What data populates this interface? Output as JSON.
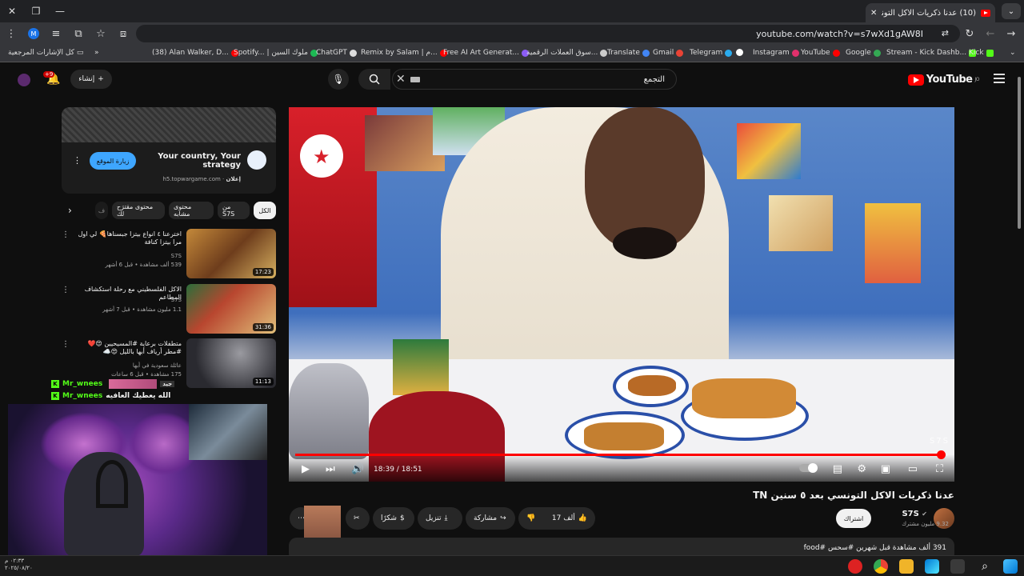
{
  "browser": {
    "tab_title": "(10) عدنا ذكريات الاكل التونسي بـ",
    "url": "youtube.com/watch?v=s7wXd1gAW8I",
    "bookmarks": [
      {
        "label": "كل الإشارات المرجعية"
      },
      {
        "label": "(38) Alan Walker, D..."
      },
      {
        "label": "Spotify... | ملوك السين"
      },
      {
        "label": "ChatGPT"
      },
      {
        "label": "Remix by Salam | م..."
      },
      {
        "label": "Free AI Art Generat..."
      },
      {
        "label": "سوق العملات الرقمية..."
      },
      {
        "label": "Translate"
      },
      {
        "label": "Gmail"
      },
      {
        "label": "Telegram"
      },
      {
        "label": "Instagram"
      },
      {
        "label": "YouTube"
      },
      {
        "label": "Google"
      },
      {
        "label": "Stream - Kick Dashb..."
      },
      {
        "label": "Kick"
      }
    ]
  },
  "header": {
    "logo_text": "YouTube",
    "logo_sup": "JO",
    "search_value": "التجمع",
    "create_label": "إنشاء",
    "notif_count": "+9"
  },
  "ad": {
    "title": "Your country, Your strategy",
    "sponsor": "إعلان",
    "domain": "h5.topwargame.com",
    "cta": "زيارة الموقع"
  },
  "chips": [
    "الكل",
    "من S7S",
    "محتوى مشابه",
    "محتوى مقترَح لك",
    "ف"
  ],
  "recommendations": [
    {
      "title": "اخترعنا ٤ انواع بيتزا جبسناها🍕 لي اول مرا بيتزا كنافة",
      "channel": "S7S",
      "views": "539 ألف مشاهدة • قبل 6 أشهر",
      "duration": "17:23"
    },
    {
      "title": "الاكل الفلسطيني مع رحلة استكشاف المطاعم",
      "channel": "S7S",
      "views": "1.1 مليون مشاهدة • قبل 7 أشهر",
      "duration": "31:36"
    },
    {
      "title": "متطفلات برعاية #المسيحيين 😍❤️ #مطر أرياف أبها بالليل 😍☁️",
      "channel": "عائلة سعودية في أبها",
      "views": "175 مشاهدة • قبل 6 ساعات",
      "duration": "11:13"
    }
  ],
  "player": {
    "current_time": "18:39",
    "total_time": "18:51",
    "progress": 0.989,
    "watermark": "S7S"
  },
  "video": {
    "title": "عدنا ذكريات الاكل التونسي بعد ٥ سنين TN",
    "channel": "S7S",
    "subscribers": "9.32 مليون مشترك",
    "subscribe_label": "اشتراك",
    "likes": "17 ألف",
    "share": "مشاركة",
    "download": "تنزيل",
    "thanks": "شكرًا",
    "views_line": "391 ألف مشاهدة  قبل شهرين  #سحس #food"
  },
  "chat": [
    {
      "user": "Mr_wnees",
      "msg": ""
    },
    {
      "user": "Mr_wnees",
      "msg": "الله يعطيك العافيه"
    }
  ],
  "overlay": {
    "emote_label": "x3",
    "emote_tag": "جيد"
  },
  "taskbar": {
    "time": "٠٢:٣٣ م",
    "date": "٢٠٢٥/٠٨/٢٠"
  },
  "colors": {
    "brand_red": "#ff0000",
    "kick_green": "#53fc18",
    "bg": "#0f0f0f"
  }
}
